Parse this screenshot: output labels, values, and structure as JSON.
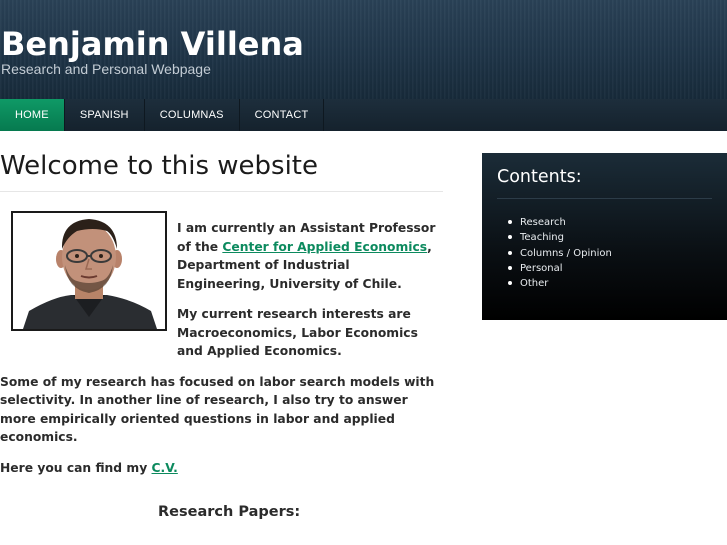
{
  "header": {
    "title": "Benjamin Villena",
    "subtitle": "Research and Personal Webpage"
  },
  "nav": {
    "items": [
      {
        "label": "HOME",
        "active": true
      },
      {
        "label": "SPANISH",
        "active": false
      },
      {
        "label": "COLUMNAS",
        "active": false
      },
      {
        "label": "CONTACT",
        "active": false
      }
    ]
  },
  "main": {
    "title": "Welcome to this website",
    "intro_before": " I am currently an Assistant Professor of the ",
    "intro_link": "Center for Applied Economics",
    "intro_after": ", Department of Industrial Engineering, University of Chile.",
    "interests": "My current research interests are Macroeconomics, Labor Economics and Applied Economics.",
    "research": "Some of my research has focused on labor search models with selectivity. In another line of research, I also try to answer more empirically oriented questions in labor and applied economics.",
    "cv_prefix": "Here you can find my ",
    "cv_link": "C.V.",
    "section_heading": "Research Papers:"
  },
  "sidebar": {
    "title": "Contents:",
    "items": [
      {
        "label": "Research"
      },
      {
        "label": "Teaching"
      },
      {
        "label": "Columns / Opinion"
      },
      {
        "label": "Personal"
      },
      {
        "label": "Other"
      }
    ]
  },
  "colors": {
    "header_bg": "#1f3548",
    "nav_active": "#0a8a5a",
    "link": "#0c8a5e",
    "sidebar_bg": "#0a0f13"
  }
}
